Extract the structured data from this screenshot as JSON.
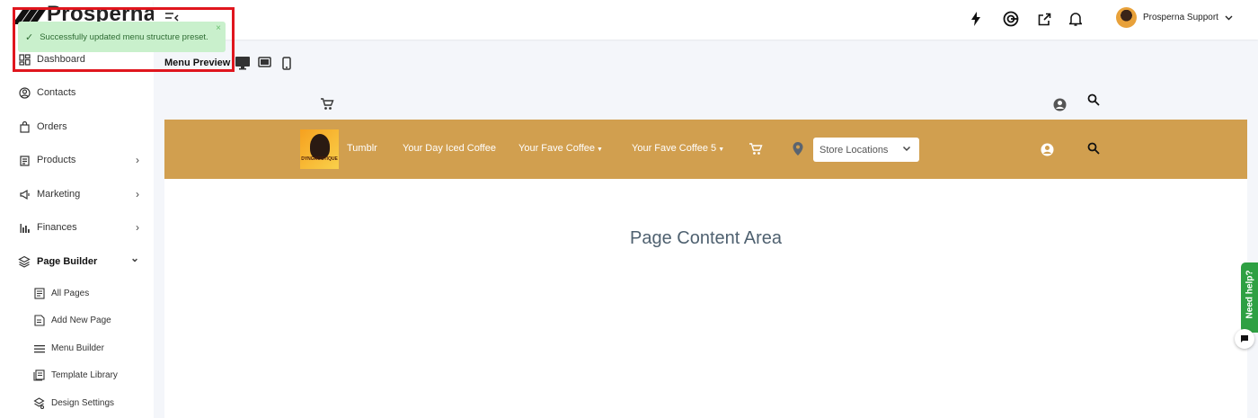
{
  "app": {
    "logo_text": "Prosperna"
  },
  "toast": {
    "message": "Successfully updated menu structure preset.",
    "close_glyph": "×"
  },
  "sidebar": {
    "items": [
      {
        "label": "Dashboard",
        "icon": "dashboard-icon"
      },
      {
        "label": "Contacts",
        "icon": "contacts-icon"
      },
      {
        "label": "Orders",
        "icon": "orders-icon"
      },
      {
        "label": "Products",
        "icon": "products-icon",
        "chevron": "›"
      },
      {
        "label": "Marketing",
        "icon": "marketing-icon",
        "chevron": "›"
      },
      {
        "label": "Finances",
        "icon": "finances-icon",
        "chevron": "›"
      },
      {
        "label": "Page Builder",
        "icon": "page-builder-icon",
        "chevron": "⌄"
      }
    ],
    "page_builder_sub": [
      {
        "label": "All Pages",
        "icon": "all-pages-icon"
      },
      {
        "label": "Add New Page",
        "icon": "add-page-icon"
      },
      {
        "label": "Menu Builder",
        "icon": "menu-icon"
      },
      {
        "label": "Template Library",
        "icon": "template-icon"
      },
      {
        "label": "Design Settings",
        "icon": "design-icon"
      }
    ]
  },
  "topbar": {
    "user_name": "Prosperna Support",
    "icons": [
      "lightning-icon",
      "target-icon",
      "external-link-icon",
      "bell-icon"
    ]
  },
  "preview": {
    "label": "Menu Preview",
    "devices": [
      "desktop-icon",
      "tablet-icon",
      "mobile-icon"
    ],
    "brand_logo_text": "DYNGROSTIQUE",
    "nav_links": [
      "Tumblr",
      "Your Day Iced Coffee",
      "Your Fave Coffee",
      "Your Fave Coffee 5"
    ],
    "store_select": "Store Locations",
    "content_area_text": "Page Content Area",
    "bar_color": "#d19f4f"
  },
  "help": {
    "label": "Need help?"
  }
}
